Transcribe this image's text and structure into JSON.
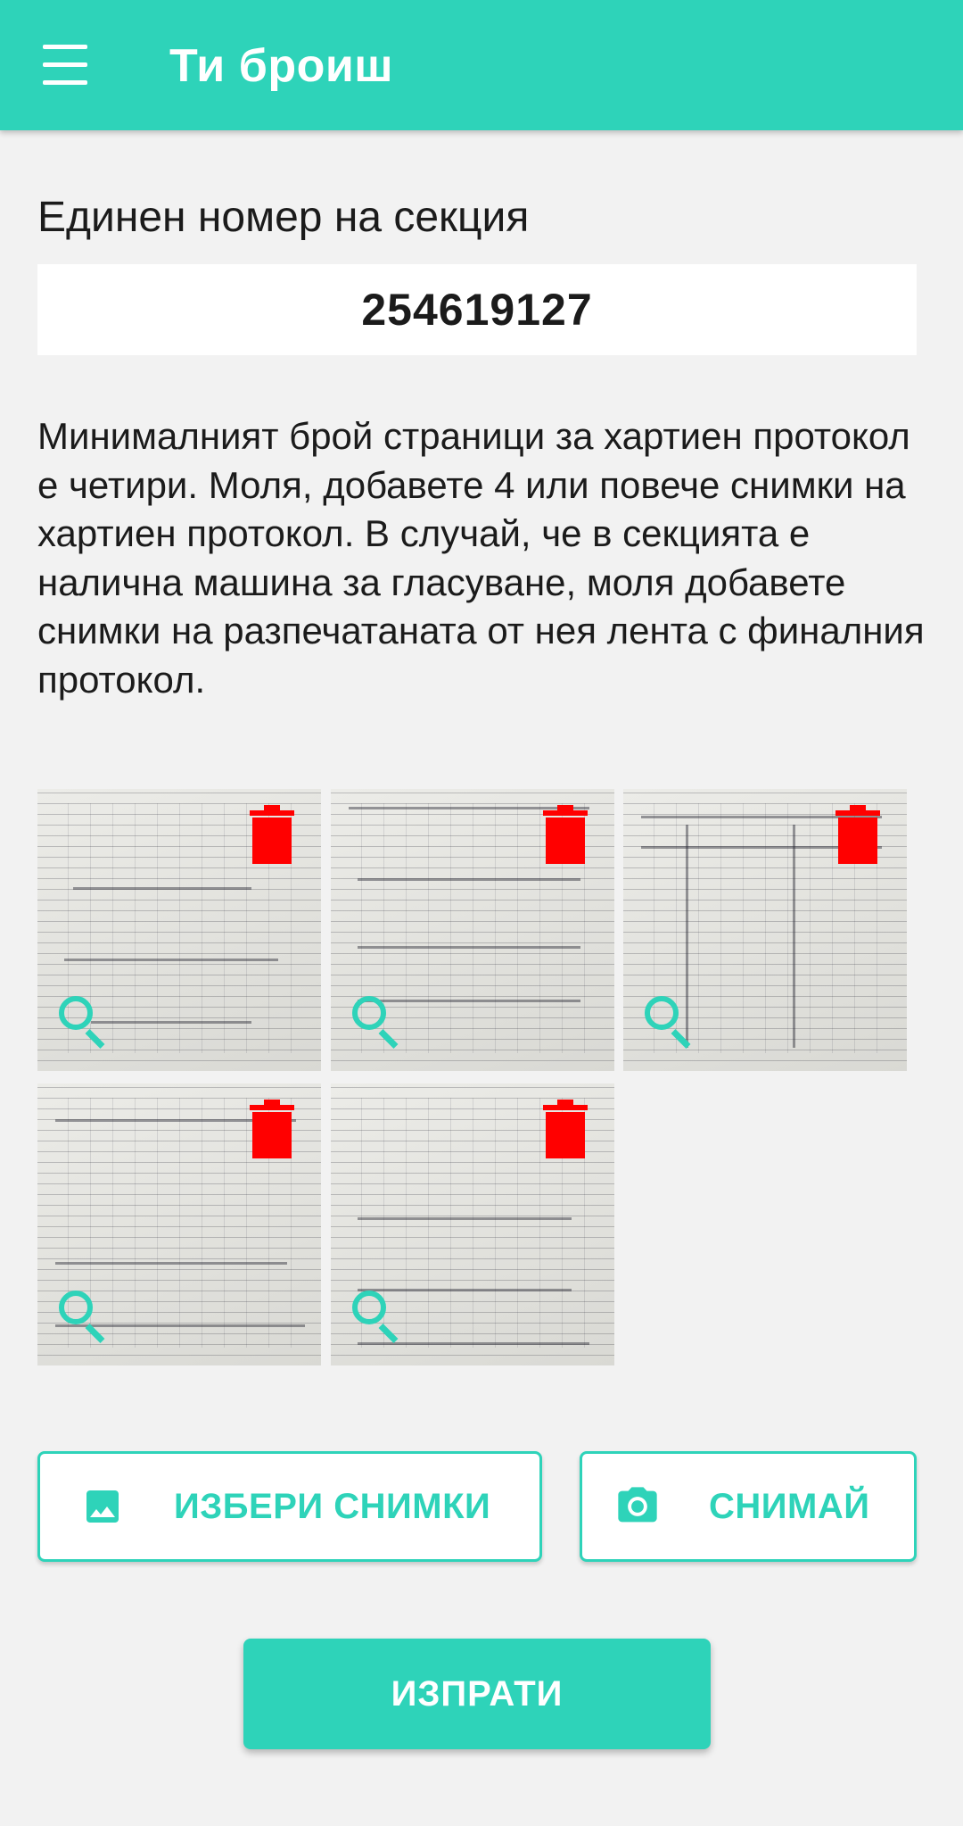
{
  "app_bar": {
    "title": "Ти броиш",
    "menu_icon": "menu-icon",
    "color": "#2ed3b9"
  },
  "section": {
    "label": "Единен номер на секция",
    "value": "254619127"
  },
  "instructions": "Минималният брой страници за хартиен протокол е четири. Моля, добавете 4 или повече снимки на хартиен протокол. В случай, че в секцията е налична машина за гласуване, моля добавете снимки на разпечатаната от нея лента с финалния протокол.",
  "photos": [
    {
      "delete_icon": "trash-icon",
      "zoom_icon": "magnifier-icon"
    },
    {
      "delete_icon": "trash-icon",
      "zoom_icon": "magnifier-icon"
    },
    {
      "delete_icon": "trash-icon",
      "zoom_icon": "magnifier-icon"
    },
    {
      "delete_icon": "trash-icon",
      "zoom_icon": "magnifier-icon"
    },
    {
      "delete_icon": "trash-icon",
      "zoom_icon": "magnifier-icon"
    }
  ],
  "actions": {
    "pick_photos_label": "ИЗБЕРИ СНИМКИ",
    "pick_photos_icon": "image-icon",
    "take_photo_label": "СНИМАЙ",
    "take_photo_icon": "camera-icon",
    "submit_label": "ИЗПРАТИ"
  },
  "colors": {
    "accent": "#2ed3b9",
    "delete": "#ff0000",
    "background": "#f2f2f2"
  }
}
